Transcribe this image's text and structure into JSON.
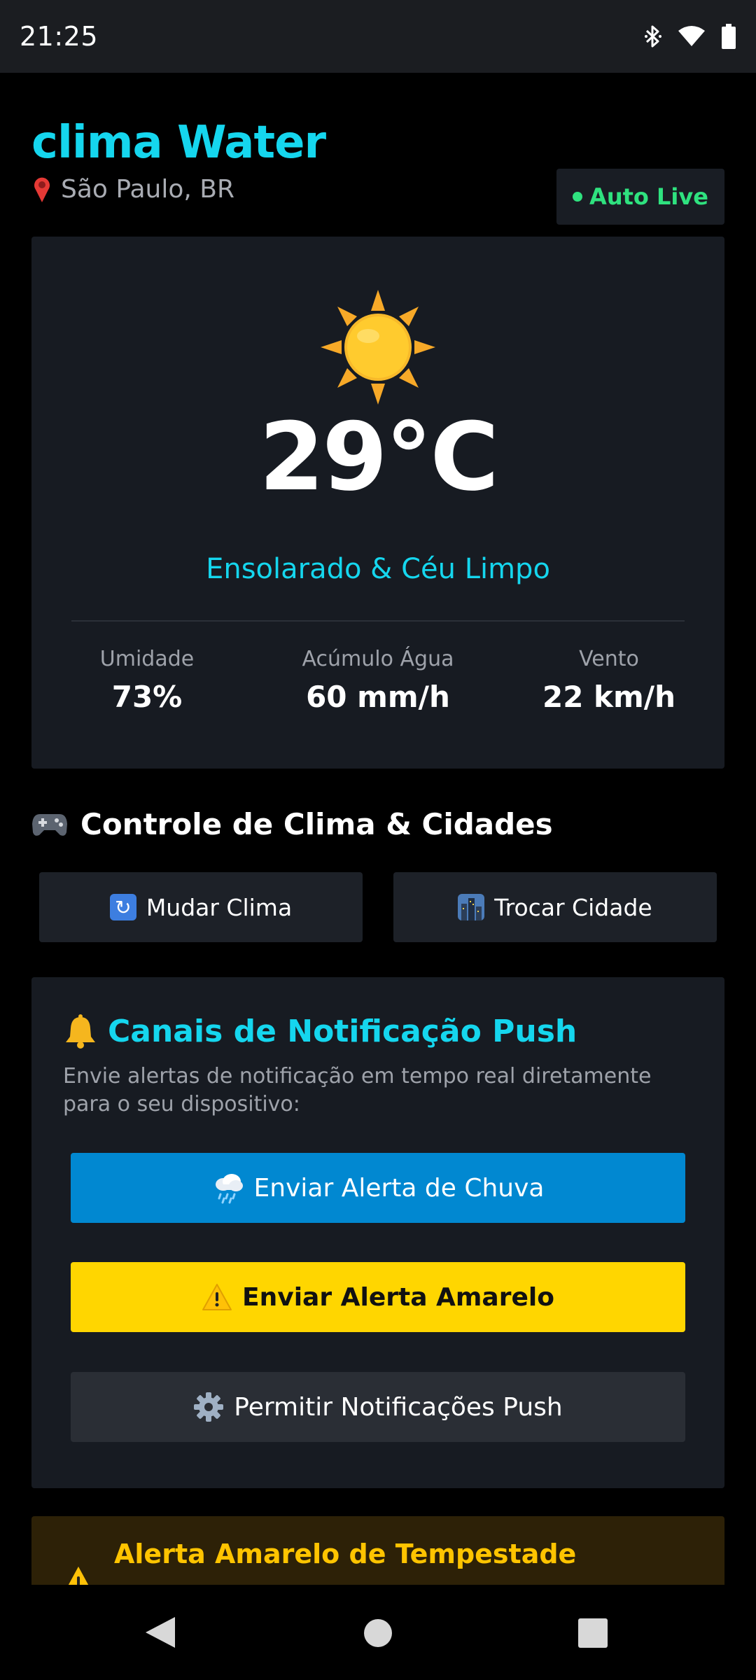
{
  "status_bar": {
    "time": "21:25",
    "icons": [
      "bluetooth-icon",
      "wifi-icon",
      "battery-icon"
    ]
  },
  "header": {
    "title": "clima Water",
    "location": "São Paulo, BR",
    "live_badge": "Auto Live"
  },
  "weather": {
    "icon": "sun-icon",
    "temperature": "29°C",
    "condition": "Ensolarado & Céu Limpo",
    "stats": [
      {
        "label": "Umidade",
        "value": "73%"
      },
      {
        "label": "Acúmulo Água",
        "value": "60 mm/h"
      },
      {
        "label": "Vento",
        "value": "22 km/h"
      }
    ]
  },
  "controls": {
    "title": "Controle de Clima & Cidades",
    "change_weather": "Mudar Clima",
    "change_city": "Trocar Cidade"
  },
  "notifications": {
    "title": "Canais de Notificação Push",
    "description": "Envie alertas de notificação em tempo real diretamente para o seu dispositivo:",
    "rain_alert": "Enviar Alerta de Chuva",
    "yellow_alert": "Enviar Alerta Amarelo",
    "permit": "Permitir Notificações Push"
  },
  "alert": {
    "title": "Alerta Amarelo de Tempestade"
  },
  "colors": {
    "accent": "#15d6ee",
    "live": "#2fe27f",
    "rain_button": "#0188d1",
    "yellow_button": "#ffd600",
    "alert_bg": "#2d2107",
    "alert_title": "#ffc400"
  }
}
